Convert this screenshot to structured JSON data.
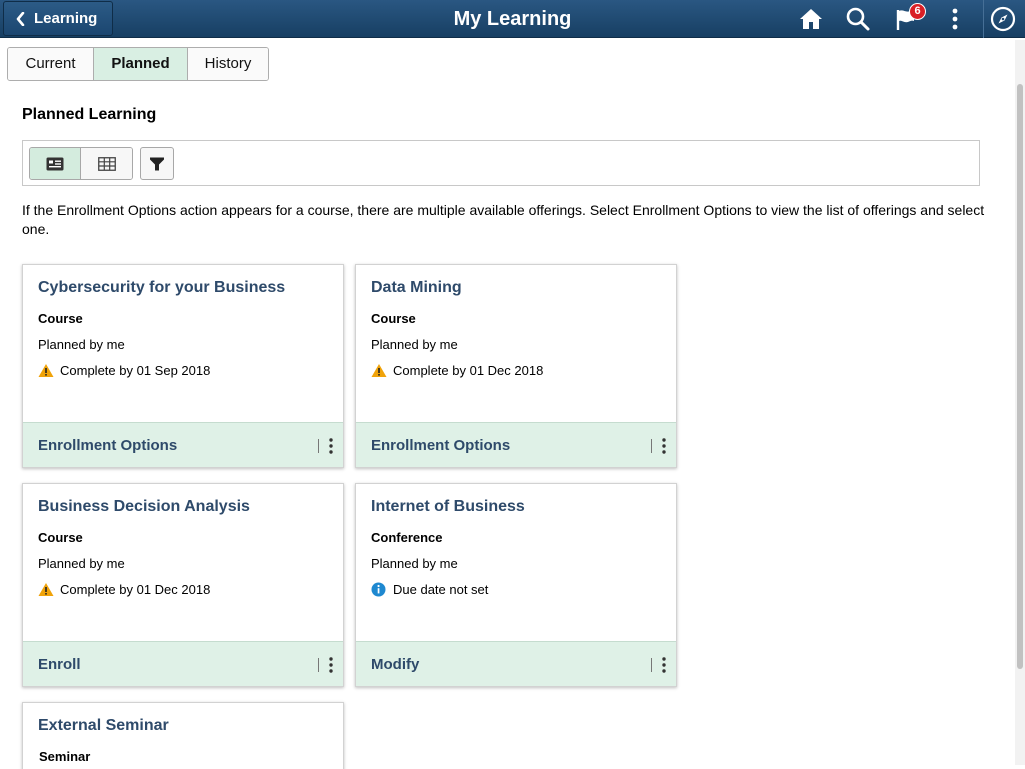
{
  "header": {
    "back_label": "Learning",
    "title": "My Learning",
    "notification_count": "6",
    "icons": [
      "home-icon",
      "search-icon",
      "flag-icon",
      "more-vertical-icon",
      "navbar-compass-icon"
    ]
  },
  "tabs": [
    {
      "label": "Current",
      "active": false
    },
    {
      "label": "Planned",
      "active": true
    },
    {
      "label": "History",
      "active": false
    }
  ],
  "section": {
    "title": "Planned Learning",
    "info": "If the Enrollment Options action appears for a course, there are multiple available offerings. Select Enrollment Options to view the list of offerings and select one."
  },
  "toolbar": {
    "views": [
      "list-view-icon",
      "grid-view-icon"
    ],
    "active_view": "list-view-icon",
    "filter": "filter-icon"
  },
  "cards": [
    {
      "title": "Cybersecurity for your Business",
      "type": "Course",
      "planned": "Planned by me",
      "status": "Complete by 01 Sep 2018",
      "status_icon": "warning-icon",
      "action": "Enrollment Options"
    },
    {
      "title": "Data Mining",
      "type": "Course",
      "planned": "Planned by me",
      "status": "Complete by 01 Dec 2018",
      "status_icon": "warning-icon",
      "action": "Enrollment Options"
    },
    {
      "title": "Business Decision Analysis",
      "type": "Course",
      "planned": "Planned by me",
      "status": "Complete by 01 Dec 2018",
      "status_icon": "warning-icon",
      "action": "Enroll"
    },
    {
      "title": "Internet of Business",
      "type": "Conference",
      "planned": "Planned by me",
      "status": "Due date not set",
      "status_icon": "info-icon",
      "action": "Modify"
    },
    {
      "title": "External Seminar",
      "type": "Seminar"
    }
  ],
  "colors": {
    "header_bg": "#1d4872",
    "active_tab_bg": "#d9efe3",
    "card_footer_bg": "#dff1e7",
    "title_text": "#2e4a6a",
    "warning": "#f0a30a",
    "info": "#1e88d0",
    "badge": "#d91f26"
  }
}
